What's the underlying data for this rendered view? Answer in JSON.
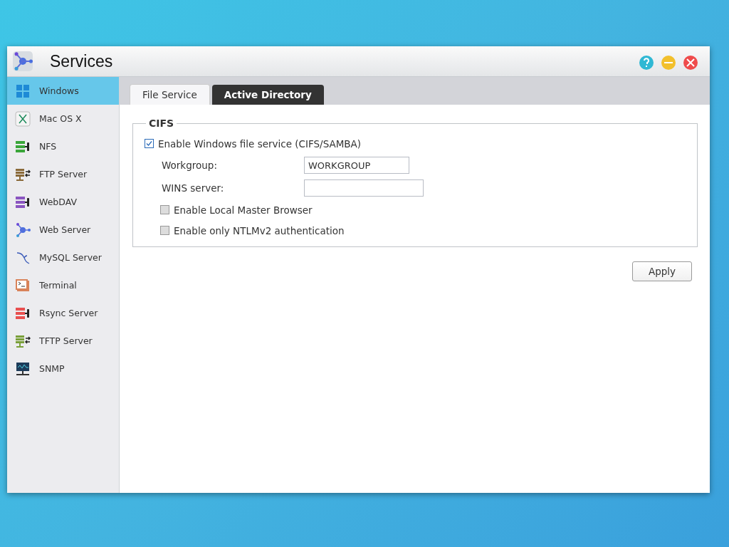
{
  "window": {
    "title": "Services"
  },
  "sidebar": {
    "items": [
      {
        "label": "Windows",
        "selected": true
      },
      {
        "label": "Mac OS X",
        "selected": false
      },
      {
        "label": "NFS",
        "selected": false
      },
      {
        "label": "FTP Server",
        "selected": false
      },
      {
        "label": "WebDAV",
        "selected": false
      },
      {
        "label": "Web Server",
        "selected": false
      },
      {
        "label": "MySQL Server",
        "selected": false
      },
      {
        "label": "Terminal",
        "selected": false
      },
      {
        "label": "Rsync Server",
        "selected": false
      },
      {
        "label": "TFTP Server",
        "selected": false
      },
      {
        "label": "SNMP",
        "selected": false
      }
    ]
  },
  "tabs": [
    {
      "label": "File Service",
      "selected": true
    },
    {
      "label": "Active Directory",
      "selected": false
    }
  ],
  "cifs": {
    "legend": "CIFS",
    "enable": {
      "label": "Enable Windows file service (CIFS/SAMBA)",
      "checked": true
    },
    "fields": [
      {
        "label": "Workgroup:",
        "value": "WORKGROUP"
      },
      {
        "label": "WINS server:"
      }
    ],
    "options": [
      {
        "label": "Enable Local Master Browser",
        "checked": false
      },
      {
        "label": "Enable only NTLMv2 authentication",
        "checked": false
      }
    ]
  },
  "buttons": [
    "Apply"
  ]
}
